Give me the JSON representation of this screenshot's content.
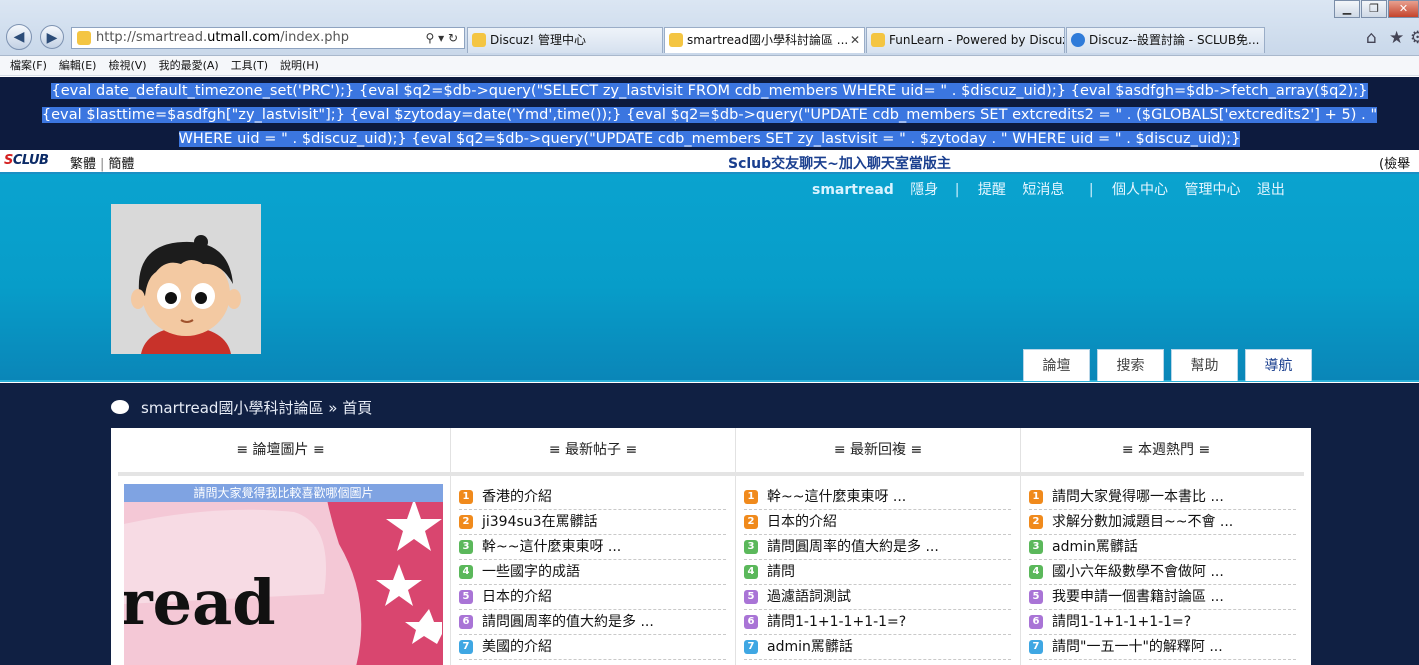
{
  "browser": {
    "url_prefix": "http://smartread.",
    "url_domain": "utmall.com",
    "url_suffix": "/index.php",
    "addr_tools": "⚲ ▾ ↻",
    "tabs": [
      {
        "title": "Discuz! 管理中心"
      },
      {
        "title": "smartread國小學科討論區 ..."
      },
      {
        "title": "FunLearn - Powered by Discuz!"
      },
      {
        "title": "Discuz--設置討論 - SCLUB免..."
      }
    ],
    "menu": [
      "檔案(F)",
      "編輯(E)",
      "檢視(V)",
      "我的最愛(A)",
      "工具(T)",
      "說明(H)"
    ]
  },
  "code_lines": [
    "{eval date_default_timezone_set('PRC');} {eval $q2=$db->query(\"SELECT zy_lastvisit FROM cdb_members WHERE uid= \" . $discuz_uid);} {eval $asdfgh=$db->fetch_array($q2);}",
    "{eval $lasttime=$asdfgh[\"zy_lastvisit\"];} {eval $zytoday=date('Ymd',time());} {eval $q2=$db->query(\"UPDATE cdb_members SET extcredits2 = \" . ($GLOBALS['extcredits2'] + 5) . \"",
    "WHERE uid = \" . $discuz_uid);} {eval $q2=$db->query(\"UPDATE cdb_members SET zy_lastvisit = \" . $zytoday . \" WHERE uid = \" . $discuz_uid);}"
  ],
  "sclub": {
    "logo_a": "S",
    "logo_b": "CLUB",
    "lang_trad": "繁體",
    "lang_simp": "簡體",
    "center": "Sclub交友聊天~加入聊天室當版主",
    "right": "(檢舉"
  },
  "user_nav": {
    "username": "smartread",
    "invisible": "隱身",
    "remind": "提醒",
    "pm": "短消息",
    "usercp": "個人中心",
    "admincp": "管理中心",
    "logout": "退出"
  },
  "nav_tabs": [
    "論壇",
    "搜索",
    "幫助",
    "導航"
  ],
  "breadcrumb": {
    "forum": "smartread國小學科討論區",
    "sep": "»",
    "home": "首頁"
  },
  "columns": {
    "pictures": "≡ 論壇圖片 ≡",
    "latest_threads": "≡ 最新帖子 ≡",
    "latest_replies": "≡ 最新回複 ≡",
    "hot_week": "≡ 本週熱門 ≡"
  },
  "picture": {
    "caption": "請問大家覺得我比較喜歡哪個圖片",
    "word": "read"
  },
  "latest_threads": [
    "香港的介紹",
    "ji394su3在罵髒話",
    "幹~~這什麼東東呀 ...",
    "一些國字的成語",
    "日本的介紹",
    "請問圓周率的值大約是多 ...",
    "美國的介紹"
  ],
  "latest_replies": [
    "幹~~這什麼東東呀 ...",
    "日本的介紹",
    "請問圓周率的值大約是多 ...",
    "請問",
    "過濾語詞測試",
    "請問1-1+1-1+1-1=?",
    "admin罵髒話"
  ],
  "hot_week": [
    "請問大家覺得哪一本書比 ...",
    "求解分數加減題目~~不會 ...",
    "admin罵髒話",
    "國小六年級數學不會做阿 ...",
    "我要申請一個書籍討論區 ...",
    "請問1-1+1-1+1-1=?",
    "請問\"一五一十\"的解釋阿 ..."
  ],
  "list_numbers": [
    "1",
    "2",
    "3",
    "4",
    "5",
    "6",
    "7"
  ]
}
